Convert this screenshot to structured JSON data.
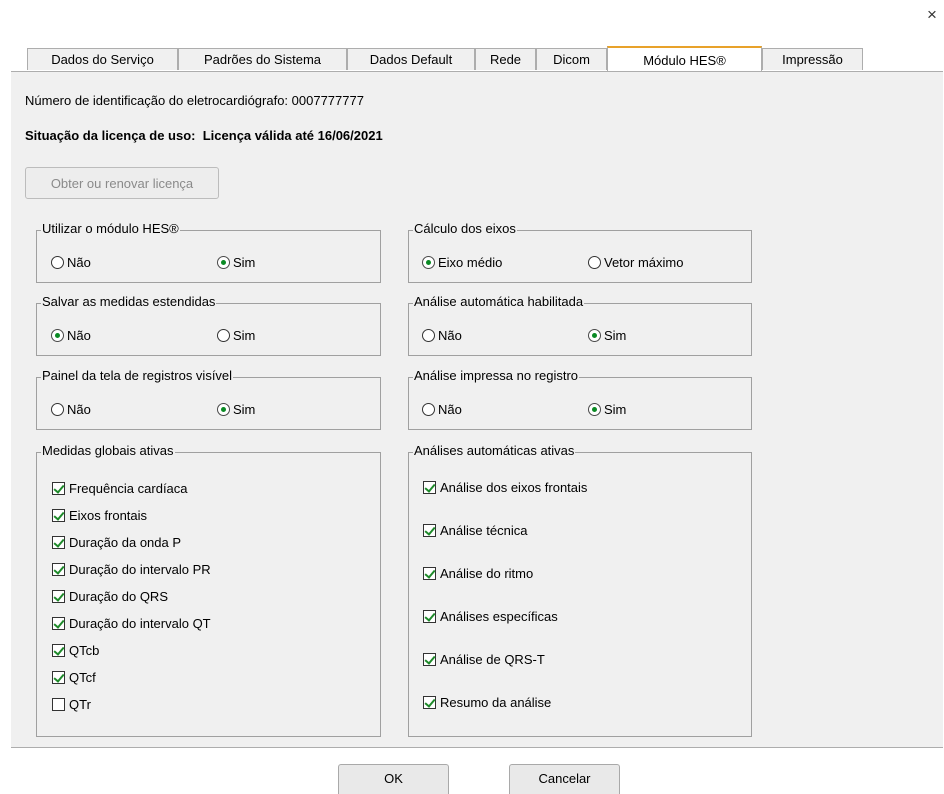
{
  "window": {
    "close_glyph": "×"
  },
  "tabs": [
    {
      "label": "Dados do Serviço"
    },
    {
      "label": "Padrões do Sistema"
    },
    {
      "label": "Dados Default"
    },
    {
      "label": "Rede"
    },
    {
      "label": "Dicom"
    },
    {
      "label": "Módulo HES®",
      "active": true
    },
    {
      "label": "Impressão"
    }
  ],
  "info": {
    "device_id_label": "Número de identificação do eletrocardiógrafo: 0007777777",
    "license_label": "Situação da licença de uso:",
    "license_value": "Licença válida até 16/06/2021",
    "renew_button": "Obter ou renovar licença"
  },
  "groups": {
    "use_hes": {
      "title": "Utilizar o módulo HES®",
      "options": [
        "Não",
        "Sim"
      ],
      "selected": "Sim"
    },
    "axis_calc": {
      "title": "Cálculo dos eixos",
      "options": [
        "Eixo médio",
        "Vetor máximo"
      ],
      "selected": "Eixo médio"
    },
    "save_extended": {
      "title": "Salvar as medidas estendidas",
      "options": [
        "Não",
        "Sim"
      ],
      "selected": "Não"
    },
    "auto_analysis": {
      "title": "Análise automática habilitada",
      "options": [
        "Não",
        "Sim"
      ],
      "selected": "Sim"
    },
    "panel_visible": {
      "title": "Painel da tela de registros visível",
      "options": [
        "Não",
        "Sim"
      ],
      "selected": "Sim"
    },
    "printed_analysis": {
      "title": "Análise impressa no registro",
      "options": [
        "Não",
        "Sim"
      ],
      "selected": "Sim"
    },
    "global_measures": {
      "title": "Medidas globais ativas",
      "items": [
        {
          "label": "Frequência cardíaca",
          "checked": true
        },
        {
          "label": "Eixos frontais",
          "checked": true
        },
        {
          "label": "Duração da onda P",
          "checked": true
        },
        {
          "label": "Duração do intervalo PR",
          "checked": true
        },
        {
          "label": "Duração do QRS",
          "checked": true
        },
        {
          "label": "Duração do intervalo QT",
          "checked": true
        },
        {
          "label": "QTcb",
          "checked": true
        },
        {
          "label": "QTcf",
          "checked": true
        },
        {
          "label": "QTr",
          "checked": false
        }
      ]
    },
    "auto_analyses": {
      "title": "Análises automáticas ativas",
      "items": [
        {
          "label": "Análise dos eixos frontais",
          "checked": true
        },
        {
          "label": "Análise técnica",
          "checked": true
        },
        {
          "label": "Análise do ritmo",
          "checked": true
        },
        {
          "label": "Análises específicas",
          "checked": true
        },
        {
          "label": "Análise de QRS-T",
          "checked": true
        },
        {
          "label": "Resumo da análise",
          "checked": true
        }
      ]
    }
  },
  "footer": {
    "ok": "OK",
    "cancel": "Cancelar"
  }
}
